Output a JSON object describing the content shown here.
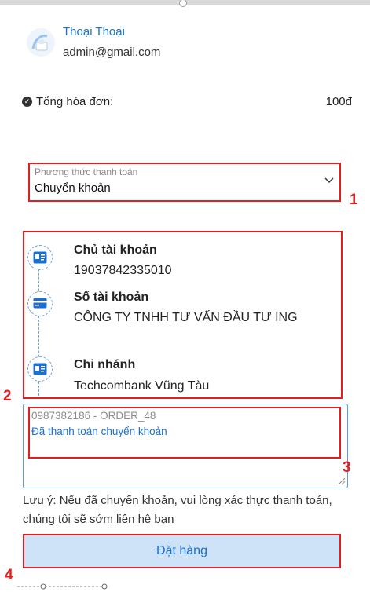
{
  "user": {
    "name": "Thoại Thoại",
    "email": "admin@gmail.com"
  },
  "order": {
    "total_label": "Tổng hóa đơn:",
    "total_value": "100đ"
  },
  "payment_method": {
    "label": "Phương thức thanh toán",
    "selected": "Chuyển khoản"
  },
  "account_info": {
    "items": [
      {
        "title": "Chủ tài khoản",
        "value": "19037842335010",
        "icon": "id-card-icon"
      },
      {
        "title": "Số tài khoản",
        "value": "CÔNG TY TNHH TƯ VẤN ĐẦU TƯ ING",
        "icon": "credit-card-icon"
      },
      {
        "title": "Chi nhánh",
        "value": "Techcombank Vũng Tàu",
        "icon": "id-card-icon"
      }
    ]
  },
  "note": {
    "placeholder": "0987382186 - ORDER_48",
    "value": "Đã thanh toán chuyển khoản"
  },
  "hint": "Lưu ý: Nếu đã chuyển khoản, vui lòng xác thực thanh toán, chúng tôi sẽ sớm liên hệ bạn",
  "order_button": {
    "label": "Đặt hàng"
  },
  "annotations": [
    "1",
    "2",
    "3",
    "4"
  ],
  "colors": {
    "accent": "#1a6fd1",
    "highlight": "#e11f1f",
    "button_bg": "#cfe3f8"
  }
}
